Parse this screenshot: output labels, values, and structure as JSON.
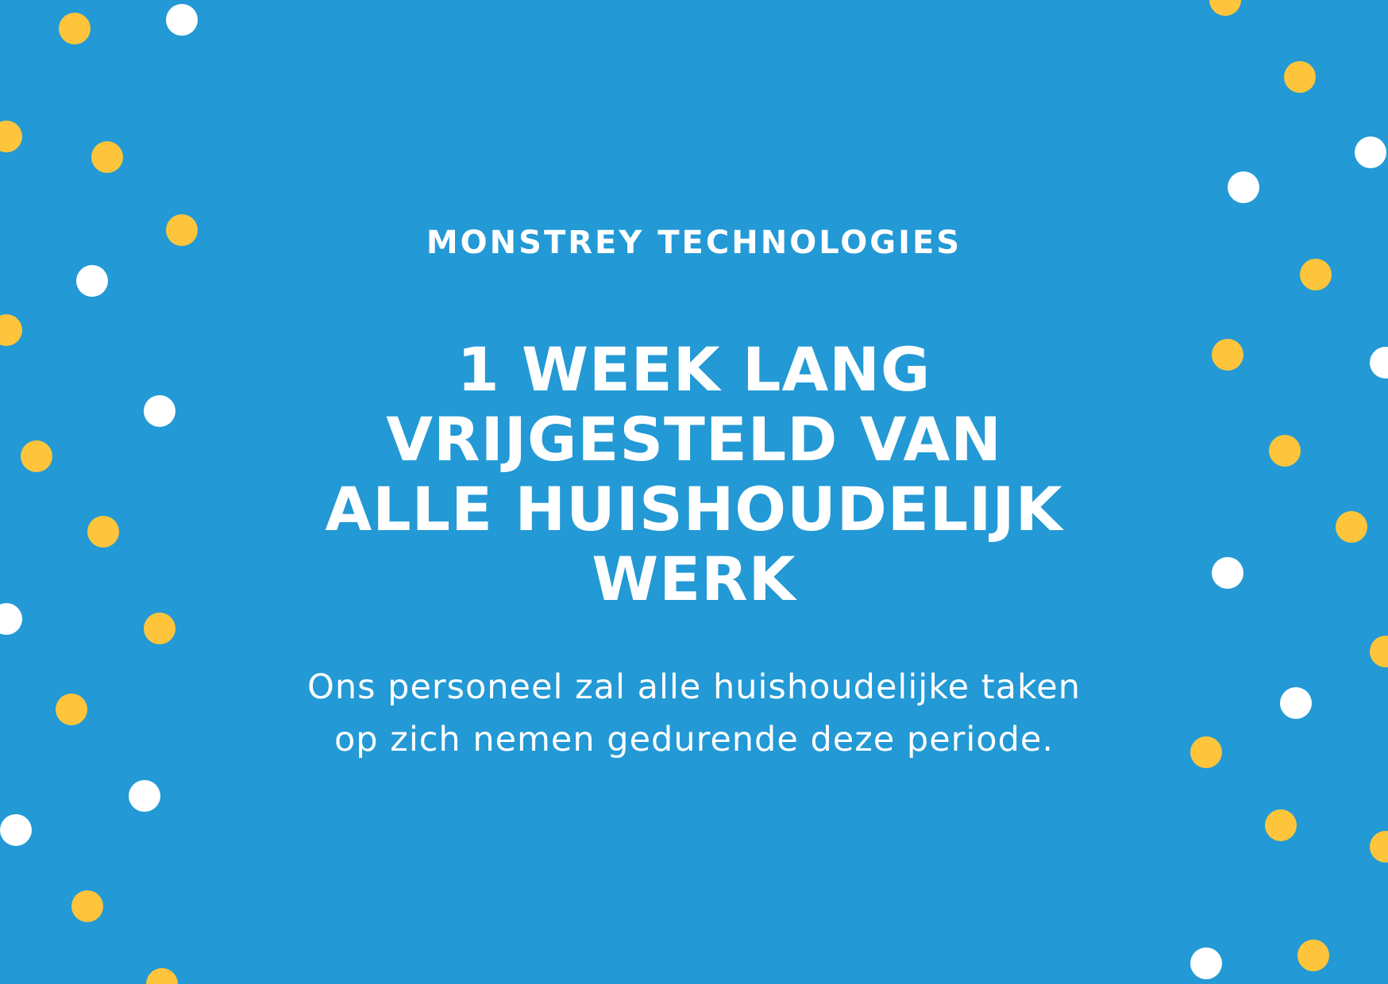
{
  "colors": {
    "background": "#2399d5",
    "text": "#ffffff",
    "dot_yellow": "#fec53c",
    "dot_white": "#ffffff"
  },
  "card": {
    "company": "MONSTREY TECHNOLOGIES",
    "headline_lines": [
      "1 WEEK LANG",
      "VRIJGESTELD VAN",
      "ALLE HUISHOUDELIJK",
      "WERK"
    ],
    "body_lines": [
      "Ons personeel zal alle huishoudelijke taken",
      "op zich nemen gedurende deze periode."
    ]
  }
}
